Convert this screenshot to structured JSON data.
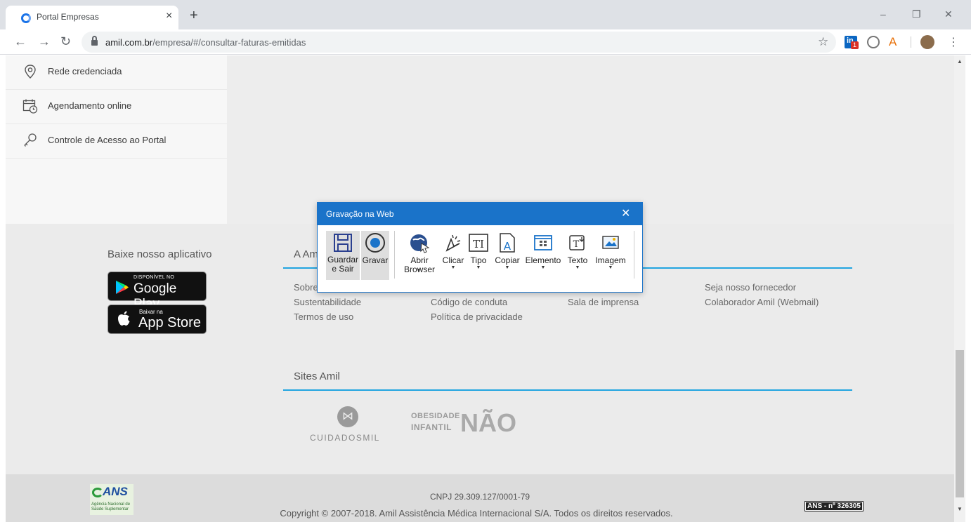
{
  "browser": {
    "tab_title": "Portal Empresas",
    "tab_close": "×",
    "new_tab": "+",
    "url_host": "amil.com.br",
    "url_path": "/empresa/#/consultar-faturas-emitidas",
    "ext_badge_count": "1",
    "window_controls": [
      "–",
      "❐",
      "✕"
    ]
  },
  "sidebar": {
    "items": [
      {
        "label": "Rede credenciada",
        "icon": "location-pin-icon"
      },
      {
        "label": "Agendamento online",
        "icon": "calendar-clock-icon"
      },
      {
        "label": "Controle de Acesso ao Portal",
        "icon": "key-icon"
      }
    ]
  },
  "footer": {
    "app_title": "Baixe nosso aplicativo",
    "google_play_small": "DISPONÍVEL NO",
    "google_play_big": "Google Play",
    "app_store_small": "Baixar na",
    "app_store_big": "App Store",
    "amil_title": "A Am",
    "links_col1": [
      "Sobre",
      "Sustentabilidade",
      "Termos de uso"
    ],
    "links_col2": [
      "Código de conduta",
      "Política de privacidade"
    ],
    "links_col3": [
      "Sala de imprensa"
    ],
    "links_col4": [
      "Seja nosso fornecedor",
      "Colaborador Amil (Webmail)"
    ],
    "sites_title": "Sites Amil",
    "cuidados_label": "CUIDADOSMIL",
    "obesidade_line1": "OBESIDADE",
    "obesidade_line2": "INFANTIL",
    "obesidade_big": "NÃO"
  },
  "bottom": {
    "ans_logo_text": "ANS",
    "ans_logo_sub": "Agência Nacional de Saúde Suplementar",
    "cnpj": "CNPJ 29.309.127/0001-79",
    "copyright": "Copyright © 2007-2018. Amil Assistência Médica Internacional S/A. Todos os direitos reservados.",
    "ans_number": "ANS - nº 326305"
  },
  "recorder": {
    "title": "Gravação na Web",
    "close": "✕",
    "tools": [
      {
        "label": "Guardar e Sair",
        "icon": "save-icon"
      },
      {
        "label": "Gravar",
        "icon": "record-icon"
      },
      {
        "label": "Abrir Browser",
        "icon": "globe-cursor-icon"
      },
      {
        "label": "Clicar",
        "icon": "click-icon"
      },
      {
        "label": "Tipo",
        "icon": "text-type-icon"
      },
      {
        "label": "Copiar",
        "icon": "copy-text-icon"
      },
      {
        "label": "Elemento",
        "icon": "element-icon"
      },
      {
        "label": "Texto",
        "icon": "text-extract-icon"
      },
      {
        "label": "Imagem",
        "icon": "image-icon"
      }
    ]
  },
  "colors": {
    "accent_blue": "#1a73c9",
    "footer_rule": "#22a5e0",
    "footer_bg": "#ebebeb"
  }
}
